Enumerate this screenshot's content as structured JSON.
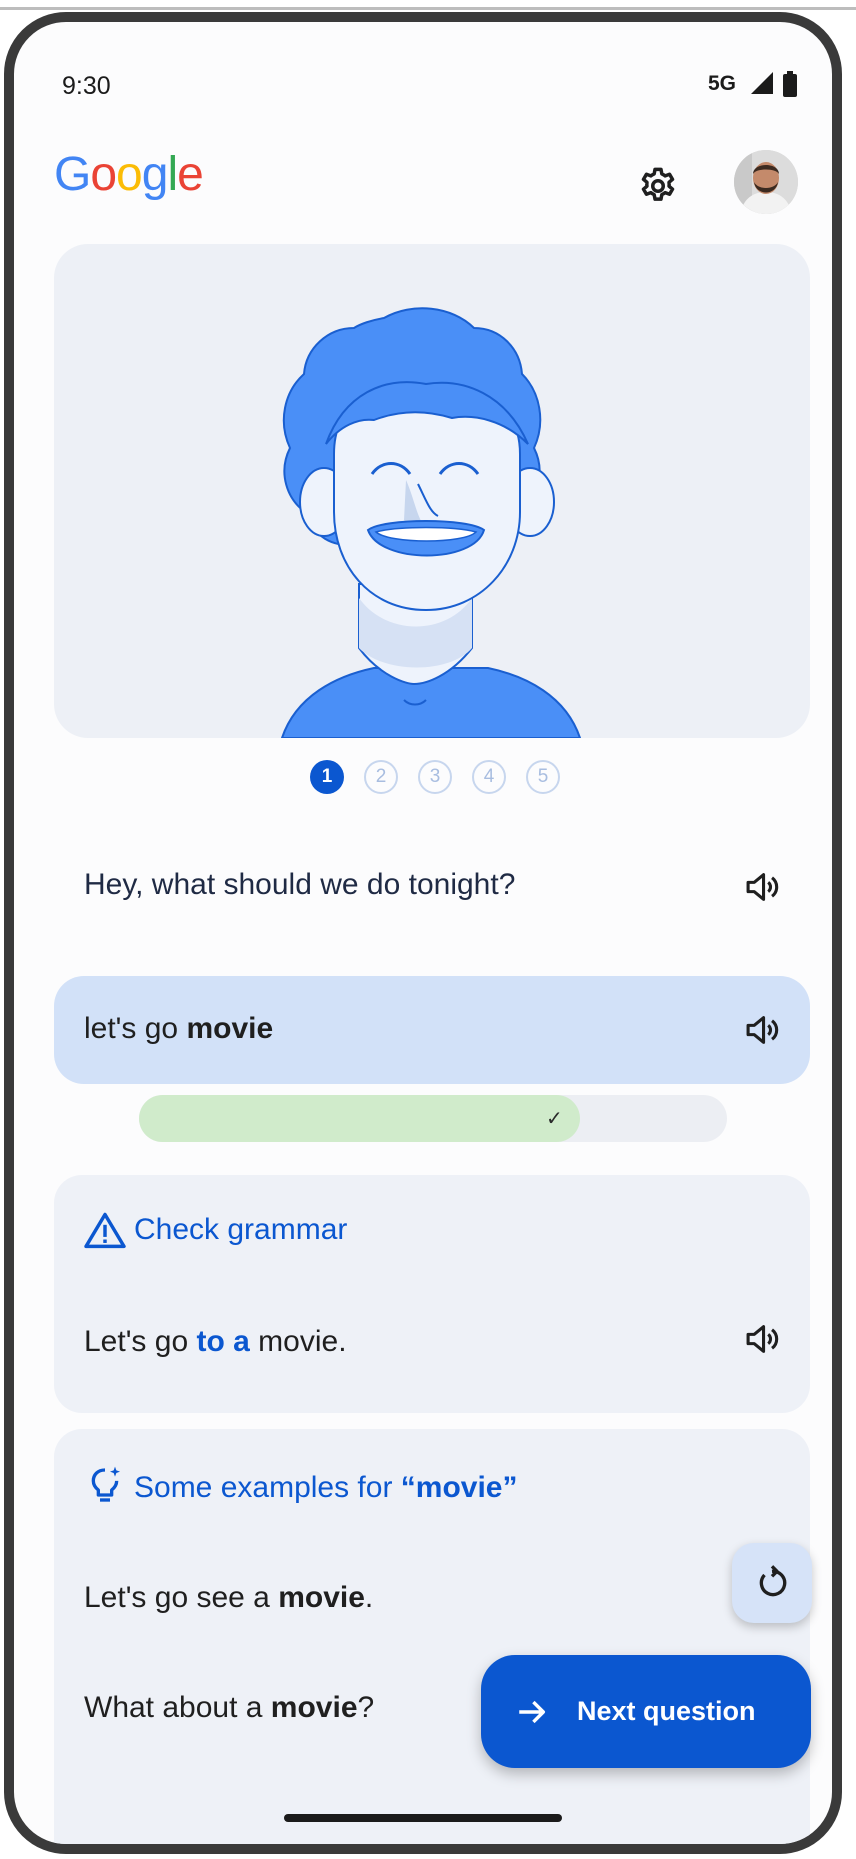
{
  "status_bar": {
    "time": "9:30",
    "network": "5G"
  },
  "header": {
    "logo": "Google",
    "settings_icon": "gear-icon",
    "avatar_icon": "profile-avatar"
  },
  "steps": {
    "current": "1",
    "items": [
      "1",
      "2",
      "3",
      "4",
      "5"
    ]
  },
  "question": {
    "text": "Hey, what should we do tonight?"
  },
  "answer": {
    "prefix": "let's go ",
    "highlight": "movie"
  },
  "score": {
    "fill_fraction": 0.75,
    "status": "✓"
  },
  "grammar": {
    "title": "Check grammar",
    "sentence_before": "Let's go ",
    "sentence_highlight": "to a",
    "sentence_after": " movie."
  },
  "examples": {
    "title_prefix": "Some examples for ",
    "title_term": "“movie”",
    "items": [
      {
        "before": "Let's go see a ",
        "bold": "movie",
        "after": "."
      },
      {
        "before": "What about a ",
        "bold": "movie",
        "after": "?"
      }
    ]
  },
  "actions": {
    "reset_icon": "refresh-icon",
    "next_label": "Next question"
  },
  "colors": {
    "accent": "#0b57d0",
    "answer_bg": "#d2e1f8",
    "progress": "#d0ebcb",
    "card_bg": "#eef1f7"
  }
}
